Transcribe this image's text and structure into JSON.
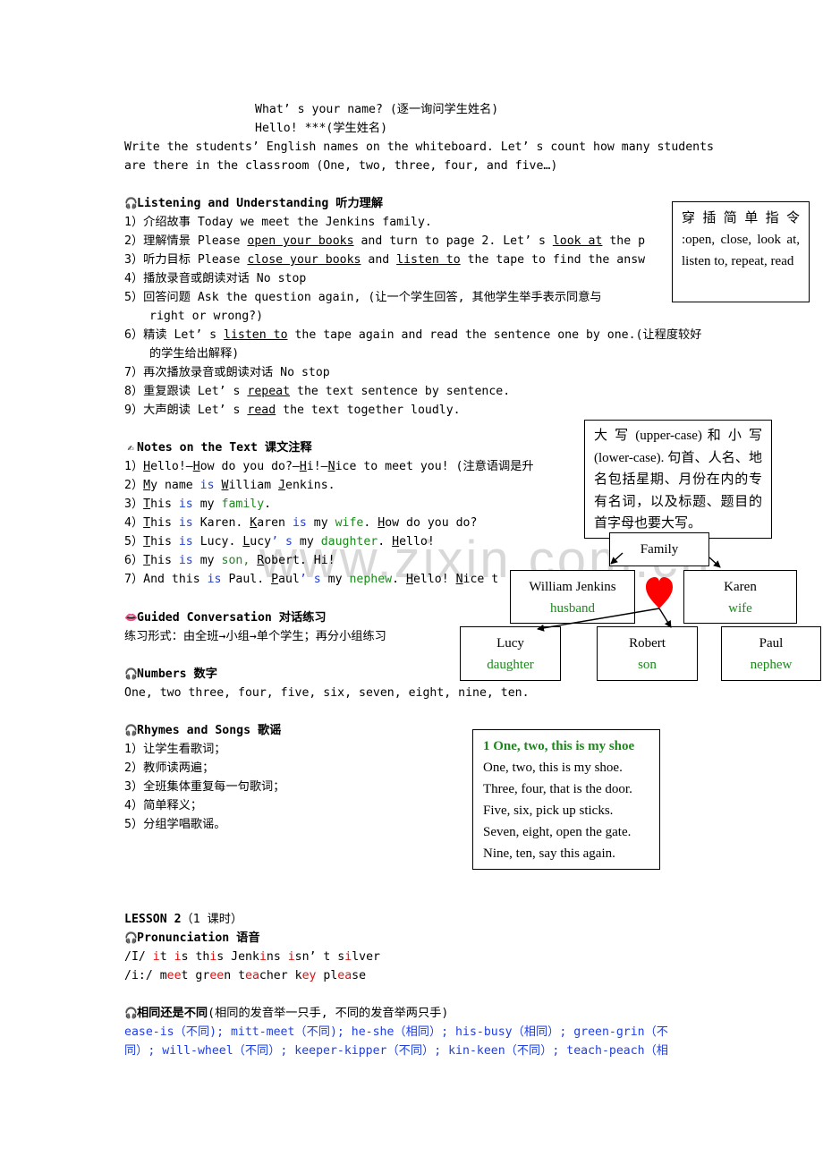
{
  "intro": {
    "line1": "What’ s your name? (逐一询问学生姓名)",
    "line2": "Hello! ***(学生姓名)",
    "line3": "  Write the students’  English names on the whiteboard. Let’ s count how many students",
    "line4": "are there in the classroom (One, two, three, four, and five…)"
  },
  "listening": {
    "title": "Listening and Understanding 听力理解",
    "items": [
      {
        "n": "1）",
        "text": "介绍故事 Today we meet the Jenkins family."
      },
      {
        "n": "2）",
        "a": "理解情景 Please ",
        "u1": "open your books",
        "b": " and turn to page 2. Let’ s ",
        "u2": "look at",
        "c": " the p"
      },
      {
        "n": "3）",
        "a": "听力目标 Please ",
        "u1": "close your books",
        "b": " and ",
        "u2": "listen to",
        "c": " the tape to find the answ"
      },
      {
        "n": "4）",
        "text": "播放录音或朗读对话 No stop"
      },
      {
        "n": "5）",
        "text": "回答问题 Ask the question again, (让一个学生回答, 其他学生举手表示同意与",
        "cont": "right or wrong?)"
      },
      {
        "n": "6）",
        "a": "精读 Let’ s ",
        "u1": "listen to",
        "b": " the tape again and read the sentence one by one.(让程度较好",
        "cont": "的学生给出解释)"
      },
      {
        "n": "7）",
        "text": "再次播放录音或朗读对话 No stop"
      },
      {
        "n": "8）",
        "a": "重复跟读 Let’ s ",
        "u1": "repeat",
        "b": " the text sentence by sentence."
      },
      {
        "n": "9）",
        "a": "大声朗读 Let’ s ",
        "u1": "read",
        "b": " the text together loudly."
      }
    ]
  },
  "instructions_box": {
    "text": "穿 插 简 单 指 令 :open, close, look at, listen to, repeat, read"
  },
  "notes": {
    "title": "Notes on the Text 课文注释",
    "items": [
      {
        "n": "1）",
        "text": "Hello!—How do you do?—Hi!—Nice to meet you! (注意语调是升"
      },
      {
        "n": "2）",
        "text": "My name is William Jenkins."
      },
      {
        "n": "3）",
        "text": "This is my family."
      },
      {
        "n": "4）",
        "text": "This is Karen. Karen is my wife. How do you do?"
      },
      {
        "n": "5）",
        "text": "This is Lucy. Lucy’ s my daughter. Hello!"
      },
      {
        "n": "6）",
        "text": "This is my son, Robert. Hi!"
      },
      {
        "n": "7）",
        "text": "And this is Paul. Paul’ s my nephew. Hello! Nice t"
      }
    ]
  },
  "case_box": {
    "text": "大 写 (upper-case) 和 小 写 (lower-case). 句首、人名、地名包括星期、月份在内的专有名词，以及标题、题目的首字母也要大写。"
  },
  "family_tree": {
    "root": "Family",
    "nodes": [
      {
        "name": "William Jenkins",
        "relation": "husband"
      },
      {
        "name": "Karen",
        "relation": "wife"
      },
      {
        "name": "Lucy",
        "relation": "daughter"
      },
      {
        "name": "Robert",
        "relation": "son"
      },
      {
        "name": "Paul",
        "relation": "nephew"
      }
    ],
    "heart_color": "#ff0000"
  },
  "guided": {
    "title": "Guided Conversation 对话练习",
    "text": "练习形式：由全班→小组→单个学生；再分小组练习"
  },
  "numbers": {
    "title": "Numbers 数字",
    "text": "One, two three, four, five, six, seven, eight, nine, ten."
  },
  "rhymes": {
    "title": "Rhymes and Songs 歌谣",
    "items": [
      {
        "n": "1）",
        "text": "让学生看歌词；"
      },
      {
        "n": "2）",
        "text": "教师读两遍；"
      },
      {
        "n": "3）",
        "text": "全班集体重复每一句歌词；"
      },
      {
        "n": "4）",
        "text": "简单释义；"
      },
      {
        "n": "5）",
        "text": "分组学唱歌谣。"
      }
    ]
  },
  "song_box": {
    "title": "1 One, two, this is my shoe",
    "lines": [
      "One, two, this is my shoe.",
      "Three, four, that is the door.",
      "Five, six, pick up sticks.",
      "Seven, eight, open the gate.",
      "Nine, ten, say this again."
    ]
  },
  "lesson2": {
    "title": "LESSON 2",
    "title_note": "（1 课时）",
    "pron_title": "Pronunciation 语音",
    "short_i_label": "/I/",
    "long_i_label": "/i:/"
  },
  "same_diff": {
    "title": "相同还是不同",
    "title_note": "(相同的发音举一只手, 不同的发音举两只手)",
    "line1": "ease-is（不同); mitt-meet（不同); he-she（相同）; his-busy（相同）; green-grin（不",
    "line2": "同）; will-wheel（不同）; keeper-kipper（不同）; kin-keen（不同）; teach-peach（相"
  },
  "watermark": "www.zixin.com.cn",
  "colors": {
    "blue": "#1f3fe0",
    "green": "#1a8a1a",
    "red": "#e01010"
  }
}
